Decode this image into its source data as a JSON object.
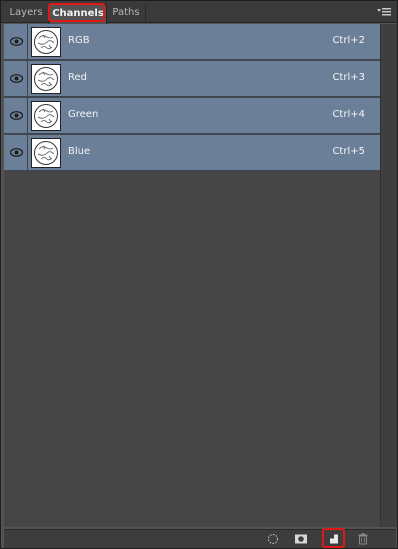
{
  "tabs": [
    {
      "label": "Layers",
      "active": false
    },
    {
      "label": "Channels",
      "active": true
    },
    {
      "label": "Paths",
      "active": false
    }
  ],
  "channels": [
    {
      "name": "RGB",
      "shortcut": "Ctrl+2",
      "visible": true,
      "selected": true,
      "icon": "eye-icon"
    },
    {
      "name": "Red",
      "shortcut": "Ctrl+3",
      "visible": true,
      "selected": true,
      "icon": "eye-icon"
    },
    {
      "name": "Green",
      "shortcut": "Ctrl+4",
      "visible": true,
      "selected": true,
      "icon": "eye-icon"
    },
    {
      "name": "Blue",
      "shortcut": "Ctrl+5",
      "visible": true,
      "selected": true,
      "icon": "eye-icon"
    }
  ],
  "toolbar": {
    "buttons": [
      {
        "name": "load-channel-as-selection",
        "icon": "dotted-selection-icon"
      },
      {
        "name": "save-selection-as-channel",
        "icon": "mask-icon"
      },
      {
        "name": "create-new-channel",
        "icon": "new-channel-icon",
        "highlighted": true
      },
      {
        "name": "delete-channel",
        "icon": "trash-icon"
      }
    ]
  },
  "colors": {
    "panel_bg": "#535353",
    "list_bg": "#464646",
    "selected_row": "#6b7f99",
    "highlight": "#e01818"
  }
}
